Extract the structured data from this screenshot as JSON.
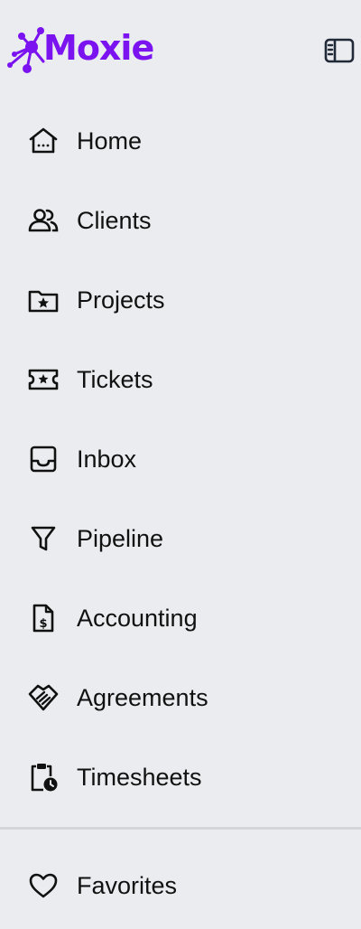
{
  "brand": {
    "name": "Moxie",
    "color": "#7b12f0"
  },
  "collapse": {
    "icon": "sidebar-collapse-icon"
  },
  "nav": {
    "items": [
      {
        "label": "Home",
        "icon": "home-icon"
      },
      {
        "label": "Clients",
        "icon": "users-icon"
      },
      {
        "label": "Projects",
        "icon": "folder-star-icon"
      },
      {
        "label": "Tickets",
        "icon": "ticket-icon"
      },
      {
        "label": "Inbox",
        "icon": "inbox-icon"
      },
      {
        "label": "Pipeline",
        "icon": "filter-icon"
      },
      {
        "label": "Accounting",
        "icon": "invoice-icon"
      },
      {
        "label": "Agreements",
        "icon": "handshake-icon"
      },
      {
        "label": "Timesheets",
        "icon": "clipboard-clock-icon"
      }
    ]
  },
  "favorites": {
    "label": "Favorites",
    "icon": "heart-icon"
  }
}
